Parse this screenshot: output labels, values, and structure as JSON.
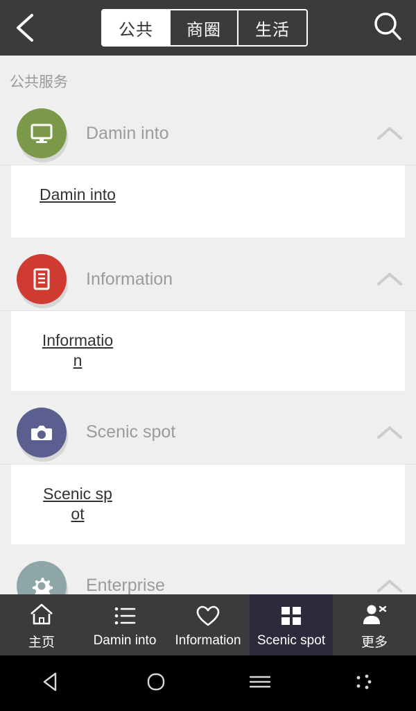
{
  "header": {
    "back_icon": "chevron-left-icon",
    "search_icon": "search-icon",
    "segments": [
      {
        "label": "公共",
        "active": true
      },
      {
        "label": "商圈",
        "active": false
      },
      {
        "label": "生活",
        "active": false
      }
    ]
  },
  "main": {
    "section_label": "公共服务",
    "groups": [
      {
        "title": "Damin into",
        "icon": "monitor-icon",
        "icon_color": "#7a9a4a",
        "expanded": true,
        "chevron_icon": "chevron-up-icon",
        "link": "Damin into"
      },
      {
        "title": "Information",
        "icon": "document-list-icon",
        "icon_color": "#cf3a31",
        "expanded": true,
        "chevron_icon": "chevron-up-icon",
        "link": "Information"
      },
      {
        "title": "Scenic spot",
        "icon": "camera-icon",
        "icon_color": "#5b5f8f",
        "expanded": true,
        "chevron_icon": "chevron-up-icon",
        "link": "Scenic spot"
      },
      {
        "title": "Enterprise",
        "icon": "gear-icon",
        "icon_color": "#8fa6a8",
        "expanded": true,
        "chevron_icon": "chevron-up-icon",
        "link": ""
      }
    ]
  },
  "tabbar": {
    "items": [
      {
        "label": "主页",
        "icon": "home-icon",
        "active": false
      },
      {
        "label": "Damin into",
        "icon": "list-icon",
        "active": false
      },
      {
        "label": "Information",
        "icon": "heart-icon",
        "active": false
      },
      {
        "label": "Scenic spot",
        "icon": "grid-icon",
        "active": true
      },
      {
        "label": "更多",
        "icon": "person-add-icon",
        "active": false
      }
    ],
    "active_bg": "#2b2b3c"
  },
  "navbar": {
    "items": [
      {
        "icon": "android-back-icon"
      },
      {
        "icon": "android-home-icon"
      },
      {
        "icon": "android-menu-icon"
      },
      {
        "icon": "android-options-icon"
      }
    ]
  },
  "colors": {
    "topbar_bg": "#3b3b3b",
    "page_bg": "#efefef",
    "panel_bg": "#ffffff",
    "title_text": "#9b9b9b"
  }
}
